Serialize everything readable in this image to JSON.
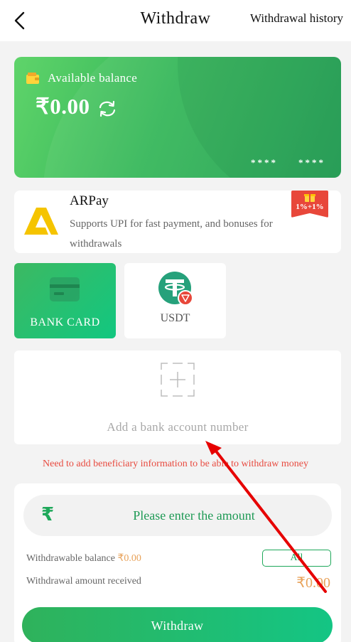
{
  "header": {
    "title": "Withdraw",
    "history_link": "Withdrawal history",
    "back_icon": "chevron-left-icon"
  },
  "balance_card": {
    "label": "Available balance",
    "amount": "₹0.00",
    "mask_left": "****",
    "mask_right": "****",
    "wallet_icon": "wallet-icon",
    "refresh_icon": "refresh-icon"
  },
  "arpay": {
    "title": "ARPay",
    "description": "Supports UPI for fast payment, and bonuses for withdrawals",
    "bonus_badge": "1%+1%",
    "logo": "arpay-logo"
  },
  "methods": [
    {
      "label": "BANK CARD",
      "icon": "bank-card-icon",
      "selected": true
    },
    {
      "label": "USDT",
      "icon": "usdt-icon",
      "selected": false
    }
  ],
  "add_account": {
    "label": "Add a bank account number",
    "icon": "add-plus-icon"
  },
  "warning": "Need to add beneficiary information to be able to withdraw money",
  "amount_panel": {
    "placeholder": "Please enter the amount",
    "currency_icon": "rupee-icon",
    "withdrawable_label": "Withdrawable balance",
    "withdrawable_value": "₹0.00",
    "all_button": "All",
    "received_label": "Withdrawal amount received",
    "received_value": "₹0.00",
    "submit_button": "Withdraw"
  },
  "colors": {
    "brand_green": "#1ea85a",
    "accent_orange": "#e8a25a",
    "warning_red": "#e84a3f"
  }
}
